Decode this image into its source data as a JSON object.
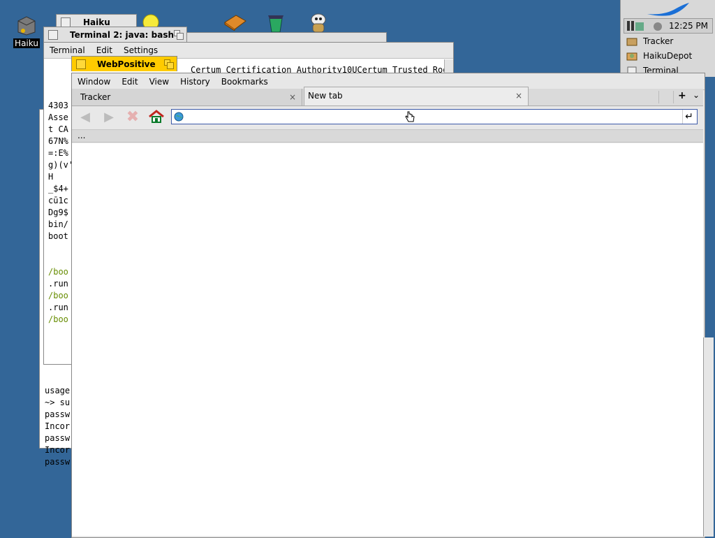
{
  "desktop": {
    "icon_haiku_label": "Haiku"
  },
  "deskbar": {
    "clock": "12:25 PM",
    "items": [
      {
        "label": "Tracker",
        "icon": "tracker-icon"
      },
      {
        "label": "HaikuDepot",
        "icon": "package-icon"
      },
      {
        "label": "Terminal",
        "icon": "terminal-icon"
      }
    ]
  },
  "back_window": {
    "title": "Haiku"
  },
  "terminal2": {
    "title": "Terminal 2: java: bash",
    "menu": [
      "Terminal",
      "Edit",
      "Settings"
    ],
    "lines": [
      "4303",
      "",
      "Asse",
      "",
      "t CA",
      "67N%",
      "=:E%",
      "g)(v'",
      "",
      "",
      "H",
      "_$4+",
      "",
      "cū1c",
      "",
      "",
      "Dg9$",
      "bin/",
      "boot",
      "/boo",
      ".run",
      "/boo",
      ".run",
      "/boo"
    ],
    "green_lines": [
      19,
      21,
      23
    ]
  },
  "terminal_behind": {
    "cert_text": "Certum Certification Authority10UCertum Trusted Roo",
    "lines": [
      "usage",
      "~> su",
      "passw",
      "Incor",
      "passw",
      "Incor",
      "passw"
    ]
  },
  "webpositive": {
    "title": "WebPositive",
    "menu": [
      "Window",
      "Edit",
      "View",
      "History",
      "Bookmarks"
    ],
    "tabs": [
      {
        "label": "Tracker",
        "close": "×"
      },
      {
        "label": "New tab",
        "close": "×"
      }
    ],
    "tab_add": "+",
    "tab_menu": "⌄",
    "url_value": "",
    "go_symbol": "↵",
    "status": "..."
  }
}
